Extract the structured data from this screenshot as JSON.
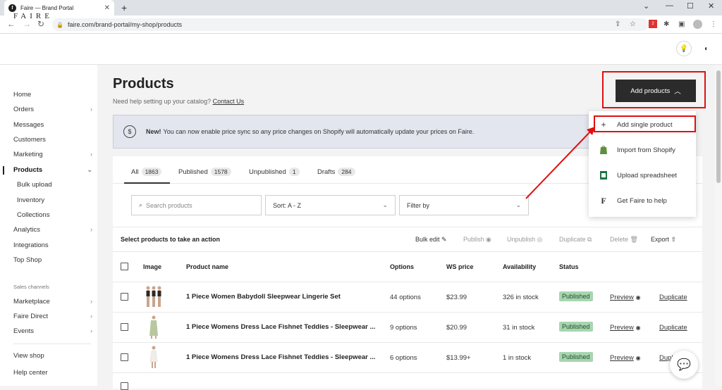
{
  "browser": {
    "tab_title": "Faire — Brand Portal",
    "url": "faire.com/brand-portal/my-shop/products"
  },
  "header": {
    "logo": "FAIRE"
  },
  "sidebar": {
    "items": [
      {
        "label": "Home"
      },
      {
        "label": "Orders",
        "chevron": true
      },
      {
        "label": "Messages"
      },
      {
        "label": "Customers"
      },
      {
        "label": "Marketing",
        "chevron": true
      },
      {
        "label": "Products",
        "chevron": true,
        "active": true,
        "expanded": true
      },
      {
        "label": "Bulk upload",
        "sub": true
      },
      {
        "label": "Inventory",
        "sub": true
      },
      {
        "label": "Collections",
        "sub": true
      },
      {
        "label": "Analytics",
        "chevron": true
      },
      {
        "label": "Integrations"
      },
      {
        "label": "Top Shop"
      }
    ],
    "section_label": "Sales channels",
    "channels": [
      {
        "label": "Marketplace"
      },
      {
        "label": "Faire Direct"
      },
      {
        "label": "Events"
      }
    ],
    "footer": [
      {
        "label": "View shop"
      },
      {
        "label": "Help center"
      }
    ]
  },
  "page": {
    "title": "Products",
    "help_text": "Need help setting up your catalog?",
    "help_link": "Contact Us",
    "add_button": "Add products"
  },
  "banner": {
    "bold": "New!",
    "text": "You can now enable price sync so any price changes on Shopify will automatically update your prices on Faire."
  },
  "tabs": [
    {
      "label": "All",
      "count": "1863"
    },
    {
      "label": "Published",
      "count": "1578"
    },
    {
      "label": "Unpublished",
      "count": "1"
    },
    {
      "label": "Drafts",
      "count": "284"
    }
  ],
  "filters": {
    "search_placeholder": "Search products",
    "sort": "Sort: A - Z",
    "filter": "Filter by"
  },
  "actions": {
    "title": "Select products to take an action",
    "items": [
      {
        "label": "Bulk edit",
        "icon": "edit-icon",
        "enabled": true
      },
      {
        "label": "Publish",
        "icon": "eye-icon",
        "enabled": false
      },
      {
        "label": "Unpublish",
        "icon": "eye-off-icon",
        "enabled": false
      },
      {
        "label": "Duplicate",
        "icon": "copy-icon",
        "enabled": false
      },
      {
        "label": "Delete",
        "icon": "trash-icon",
        "enabled": false
      },
      {
        "label": "Export",
        "icon": "export-icon",
        "enabled": true
      }
    ]
  },
  "table": {
    "headers": [
      "Image",
      "Product name",
      "Options",
      "WS price",
      "Availability",
      "Status"
    ],
    "rows": [
      {
        "name": "1 Piece Women Babydoll Sleepwear Lingerie Set",
        "options": "44 options",
        "price": "$23.99",
        "availability": "326 in stock",
        "status": "Published",
        "preview": "Preview",
        "duplicate": "Duplicate"
      },
      {
        "name": "1 Piece Womens Dress Lace Fishnet Teddies - Sleepwear ...",
        "options": "9 options",
        "price": "$20.99",
        "availability": "31 in stock",
        "status": "Published",
        "preview": "Preview",
        "duplicate": "Duplicate"
      },
      {
        "name": "1 Piece Womens Dress Lace Fishnet Teddies - Sleepwear ...",
        "options": "6 options",
        "price": "$13.99+",
        "availability": "1 in stock",
        "status": "Published",
        "preview": "Preview",
        "duplicate": "Duplicate"
      }
    ]
  },
  "menu": {
    "items": [
      {
        "label": "Add single product",
        "icon": "plus-icon"
      },
      {
        "label": "Import from Shopify",
        "icon": "shopify-icon"
      },
      {
        "label": "Upload spreadsheet",
        "icon": "spreadsheet-icon"
      },
      {
        "label": "Get Faire to help",
        "icon": "faire-f-icon"
      }
    ]
  },
  "colors": {
    "primary_button": "#2b2b2b",
    "highlight": "#e01010",
    "published_badge": "#a8d5b0",
    "banner_bg": "#e4e6ef"
  }
}
